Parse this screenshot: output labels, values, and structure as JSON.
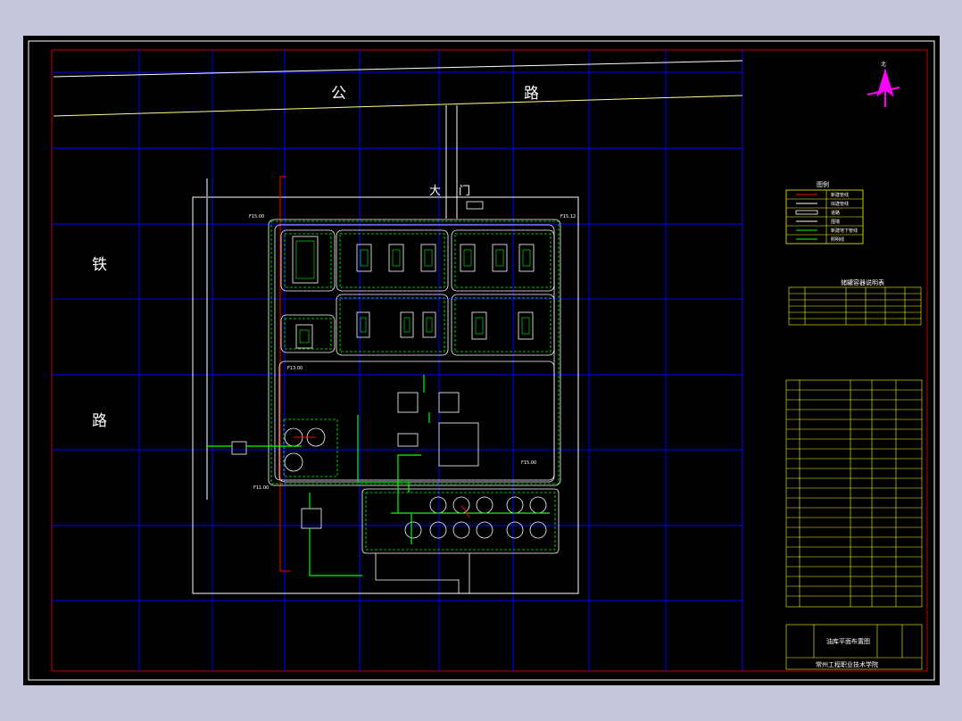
{
  "drawing": {
    "road_highway_left": "公",
    "road_highway_right": "路",
    "road_railway_top": "铁",
    "road_railway_bottom": "路",
    "gate_left": "大",
    "gate_right": "门",
    "north_label": "北",
    "elevation_labels": [
      "F15.00",
      "F15.12",
      "F13.00",
      "F15.00",
      "F11.00"
    ]
  },
  "legend": {
    "title": "图例",
    "items": [
      "新建管线",
      "拟建管线",
      "道路",
      "围墙",
      "新建地下管线",
      "照明线"
    ]
  },
  "table1": {
    "title": "储罐容器说明表",
    "rows": 6,
    "cols": 6
  },
  "table2": {
    "rows": 23
  },
  "title_block": {
    "title": "油库平面布置图",
    "school": "常州工程职业技术学院"
  },
  "colors": {
    "grid": "#0000ff",
    "line": "#ffffff",
    "pipe": "#00ff00",
    "table": "#ffff00",
    "red": "#ff0000",
    "north": "#ff00ff"
  }
}
